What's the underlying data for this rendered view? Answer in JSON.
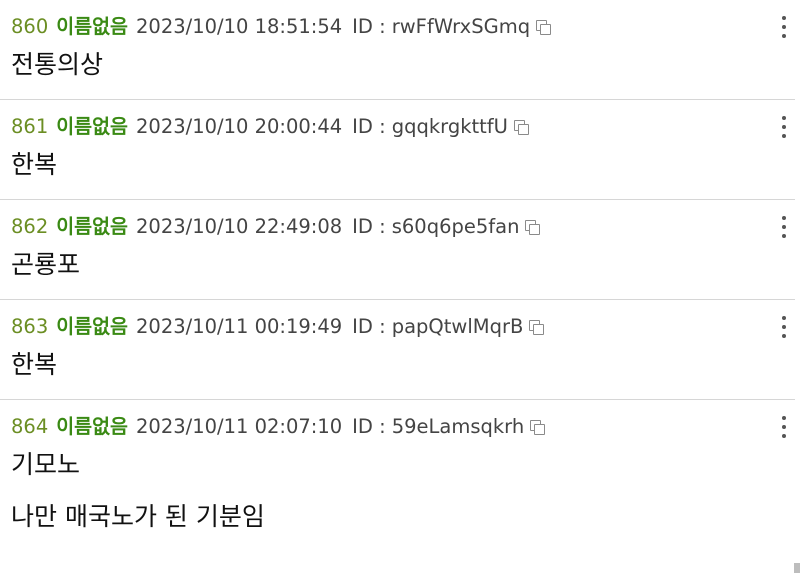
{
  "posts": [
    {
      "number": "860",
      "name": "이름없음",
      "datetime": "2023/10/10 18:51:54",
      "id_label": "ID :",
      "id": "rwFfWrxSGmq",
      "lines": [
        "전통의상"
      ]
    },
    {
      "number": "861",
      "name": "이름없음",
      "datetime": "2023/10/10 20:00:44",
      "id_label": "ID :",
      "id": "gqqkrgkttfU",
      "lines": [
        "한복"
      ]
    },
    {
      "number": "862",
      "name": "이름없음",
      "datetime": "2023/10/10 22:49:08",
      "id_label": "ID :",
      "id": "s60q6pe5fan",
      "lines": [
        "곤룡포"
      ]
    },
    {
      "number": "863",
      "name": "이름없음",
      "datetime": "2023/10/11 00:19:49",
      "id_label": "ID :",
      "id": "papQtwlMqrB",
      "lines": [
        "한복"
      ]
    },
    {
      "number": "864",
      "name": "이름없음",
      "datetime": "2023/10/11 02:07:10",
      "id_label": "ID :",
      "id": "59eLamsqkrh",
      "lines": [
        "기모노",
        "나만 매국노가 된 기분임"
      ]
    }
  ],
  "icons": {
    "copy": "copy-icon",
    "menu": "more-vertical-icon"
  },
  "colors": {
    "number": "#6b8e23",
    "name": "#3a8a14",
    "divider": "#d6d6d6"
  }
}
